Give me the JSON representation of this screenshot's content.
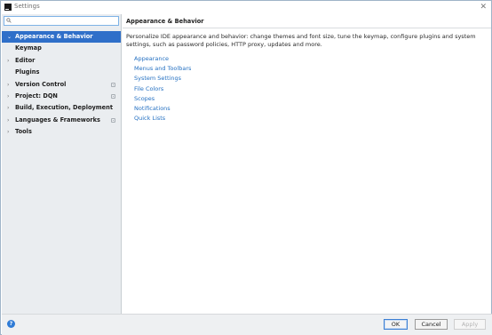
{
  "window": {
    "title": "Settings",
    "close_glyph": "✕"
  },
  "search": {
    "placeholder": "Q▾",
    "value": ""
  },
  "sidebar": {
    "items": [
      {
        "label": "Appearance & Behavior",
        "expandable": true,
        "selected": true,
        "project_icon": false
      },
      {
        "label": "Keymap",
        "expandable": false,
        "selected": false,
        "project_icon": false
      },
      {
        "label": "Editor",
        "expandable": true,
        "selected": false,
        "project_icon": false
      },
      {
        "label": "Plugins",
        "expandable": false,
        "selected": false,
        "project_icon": false
      },
      {
        "label": "Version Control",
        "expandable": true,
        "selected": false,
        "project_icon": true
      },
      {
        "label": "Project: DQN",
        "expandable": true,
        "selected": false,
        "project_icon": true
      },
      {
        "label": "Build, Execution, Deployment",
        "expandable": true,
        "selected": false,
        "project_icon": false
      },
      {
        "label": "Languages & Frameworks",
        "expandable": true,
        "selected": false,
        "project_icon": true
      },
      {
        "label": "Tools",
        "expandable": true,
        "selected": false,
        "project_icon": false
      }
    ],
    "arrow_collapsed": "›",
    "arrow_expanded": "⌄"
  },
  "main": {
    "title": "Appearance & Behavior",
    "description": "Personalize IDE appearance and behavior: change themes and font size, tune the keymap, configure plugins and system settings, such as password policies, HTTP proxy, updates and more.",
    "links": [
      "Appearance",
      "Menus and Toolbars",
      "System Settings",
      "File Colors",
      "Scopes",
      "Notifications",
      "Quick Lists"
    ]
  },
  "footer": {
    "help_label": "?",
    "ok_label": "OK",
    "cancel_label": "Cancel",
    "apply_label": "Apply"
  },
  "colors": {
    "accent": "#2f6fc9",
    "link": "#2470c2",
    "sidebar_bg": "#eaedf0"
  }
}
